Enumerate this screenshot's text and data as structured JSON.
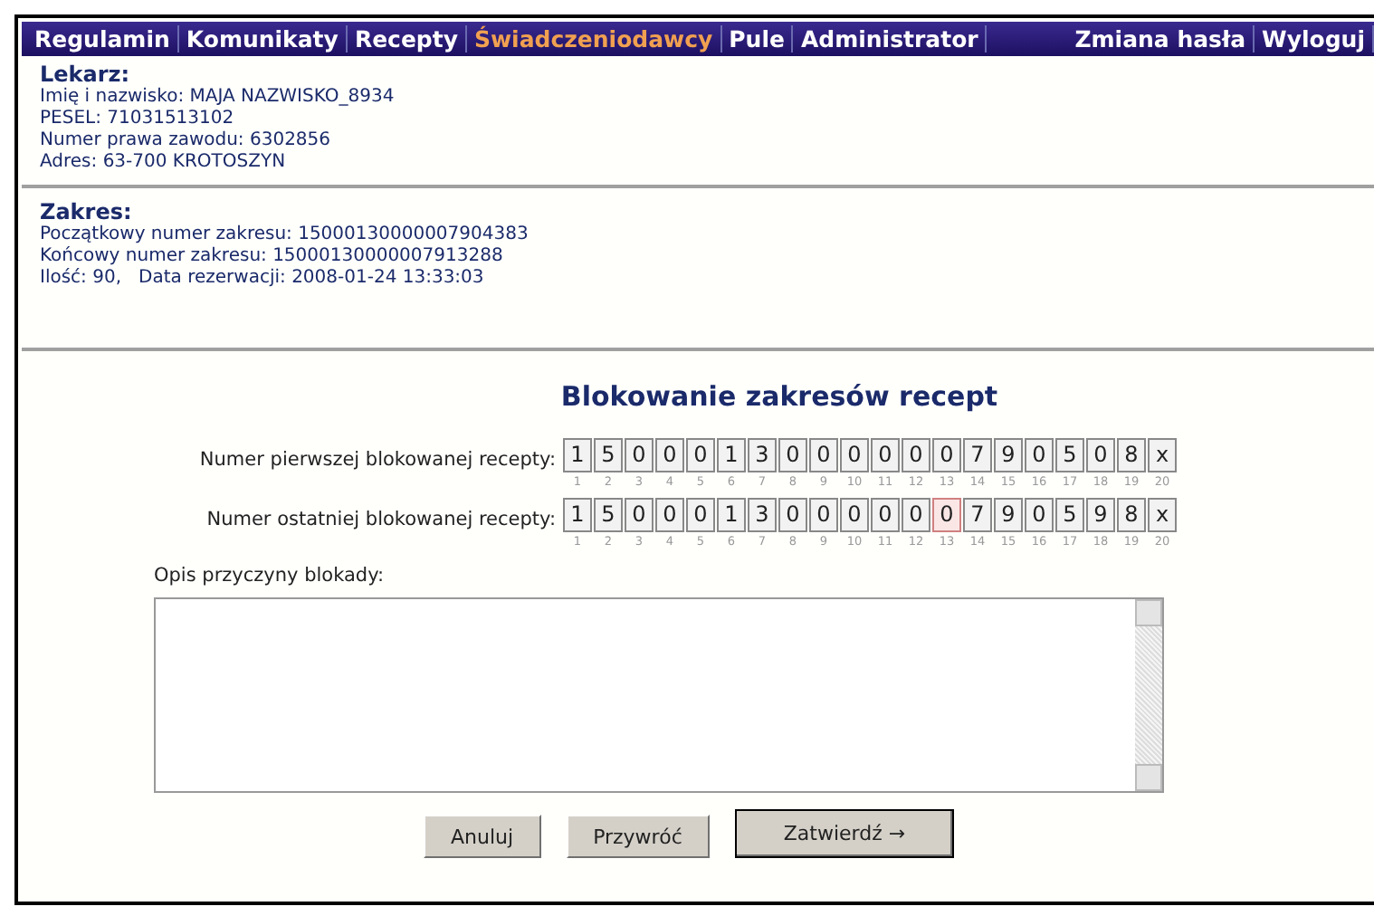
{
  "menu": [
    {
      "label": "Regulamin",
      "selected": false
    },
    {
      "label": "Komunikaty",
      "selected": false
    },
    {
      "label": "Recepty",
      "selected": false
    },
    {
      "label": "Świadczeniodawcy",
      "selected": true
    },
    {
      "label": "Pule",
      "selected": false
    },
    {
      "label": "Administrator",
      "selected": false
    }
  ],
  "menu_right": [
    {
      "label": "Zmiana hasła"
    },
    {
      "label": "Wyloguj"
    }
  ],
  "doctor": {
    "heading": "Lekarz:",
    "lines": [
      "Imię i nazwisko: MAJA NAZWISKO_8934",
      "PESEL: 71031513102",
      "Numer prawa zawodu: 6302856",
      "Adres: 63-700 KROTOSZYN"
    ]
  },
  "range": {
    "heading": "Zakres:",
    "lines": [
      "Początkowy numer zakresu: 15000130000007904383",
      "Końcowy numer zakresu: 15000130000007913288",
      "Ilość: 90,   Data rezerwacji: 2008-01-24 13:33:03"
    ]
  },
  "form": {
    "title": "Blokowanie zakresów recept",
    "number_rows": [
      {
        "label": "Numer pierwszej blokowanej recepty:",
        "digits": [
          {
            "value": "1",
            "index": "1",
            "error": false
          },
          {
            "value": "5",
            "index": "2",
            "error": false
          },
          {
            "value": "0",
            "index": "3",
            "error": false
          },
          {
            "value": "0",
            "index": "4",
            "error": false
          },
          {
            "value": "0",
            "index": "5",
            "error": false
          },
          {
            "value": "1",
            "index": "6",
            "error": false
          },
          {
            "value": "3",
            "index": "7",
            "error": false
          },
          {
            "value": "0",
            "index": "8",
            "error": false
          },
          {
            "value": "0",
            "index": "9",
            "error": false
          },
          {
            "value": "0",
            "index": "10",
            "error": false
          },
          {
            "value": "0",
            "index": "11",
            "error": false
          },
          {
            "value": "0",
            "index": "12",
            "error": false
          },
          {
            "value": "0",
            "index": "13",
            "error": false
          },
          {
            "value": "7",
            "index": "14",
            "error": false
          },
          {
            "value": "9",
            "index": "15",
            "error": false
          },
          {
            "value": "0",
            "index": "16",
            "error": false
          },
          {
            "value": "5",
            "index": "17",
            "error": false
          },
          {
            "value": "0",
            "index": "18",
            "error": false
          },
          {
            "value": "8",
            "index": "19",
            "error": false
          },
          {
            "value": "x",
            "index": "20",
            "error": false
          }
        ]
      },
      {
        "label": "Numer ostatniej blokowanej recepty:",
        "digits": [
          {
            "value": "1",
            "index": "1",
            "error": false
          },
          {
            "value": "5",
            "index": "2",
            "error": false
          },
          {
            "value": "0",
            "index": "3",
            "error": false
          },
          {
            "value": "0",
            "index": "4",
            "error": false
          },
          {
            "value": "0",
            "index": "5",
            "error": false
          },
          {
            "value": "1",
            "index": "6",
            "error": false
          },
          {
            "value": "3",
            "index": "7",
            "error": false
          },
          {
            "value": "0",
            "index": "8",
            "error": false
          },
          {
            "value": "0",
            "index": "9",
            "error": false
          },
          {
            "value": "0",
            "index": "10",
            "error": false
          },
          {
            "value": "0",
            "index": "11",
            "error": false
          },
          {
            "value": "0",
            "index": "12",
            "error": false
          },
          {
            "value": "0",
            "index": "13",
            "error": true
          },
          {
            "value": "7",
            "index": "14",
            "error": false
          },
          {
            "value": "9",
            "index": "15",
            "error": false
          },
          {
            "value": "0",
            "index": "16",
            "error": false
          },
          {
            "value": "5",
            "index": "17",
            "error": false
          },
          {
            "value": "9",
            "index": "18",
            "error": false
          },
          {
            "value": "8",
            "index": "19",
            "error": false
          },
          {
            "value": "x",
            "index": "20",
            "error": false
          }
        ]
      }
    ],
    "reason_label": "Opis przyczyny blokady:",
    "buttons": [
      {
        "label": "Anuluj",
        "kind": "plain"
      },
      {
        "label": "Przywróć",
        "kind": "plain"
      },
      {
        "label": "Zatwierdź →",
        "kind": "primary"
      }
    ]
  }
}
